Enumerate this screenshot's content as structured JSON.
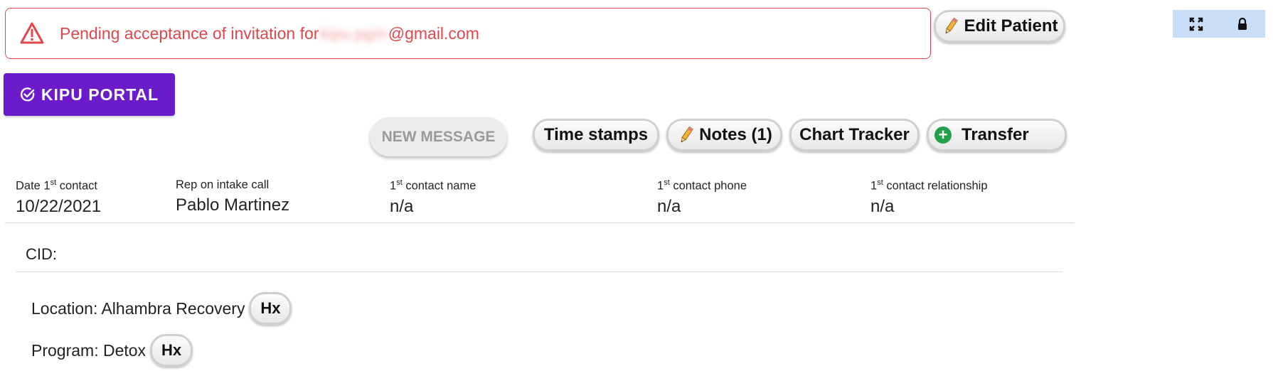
{
  "alert": {
    "prefix": "Pending acceptance of invitation for",
    "suffix": "@gmail.com",
    "color": "#e0474c"
  },
  "buttons": {
    "edit_patient": "Edit Patient",
    "kipu_portal": "KIPU PORTAL",
    "new_message": "NEW MESSAGE",
    "time_stamps": "Time stamps",
    "notes": "Notes (1)",
    "chart_tracker": "Chart Tracker",
    "transfer": "Transfer",
    "hx": "Hx"
  },
  "toolbar": {
    "icons": [
      "expand-icon",
      "lock-icon"
    ]
  },
  "contact": {
    "date_label_pre": "Date 1",
    "date_label_post": " contact",
    "sup": "st",
    "date_value": "10/22/2021",
    "rep_label": "Rep on intake call",
    "rep_value": "Pablo Martinez",
    "name_label_pre": "1",
    "name_label_post": " contact name",
    "name_value": "n/a",
    "phone_label_pre": "1",
    "phone_label_post": " contact phone",
    "phone_value": "n/a",
    "rel_label_pre": "1",
    "rel_label_post": " contact relationship",
    "rel_value": "n/a"
  },
  "details": {
    "cid_label": "CID:",
    "location": "Location: Alhambra Recovery",
    "program": "Program: Detox"
  },
  "colors": {
    "brand_purple": "#6b1bc9",
    "toolbar_bg": "#c8ddf6",
    "success_green": "#23a14a"
  }
}
